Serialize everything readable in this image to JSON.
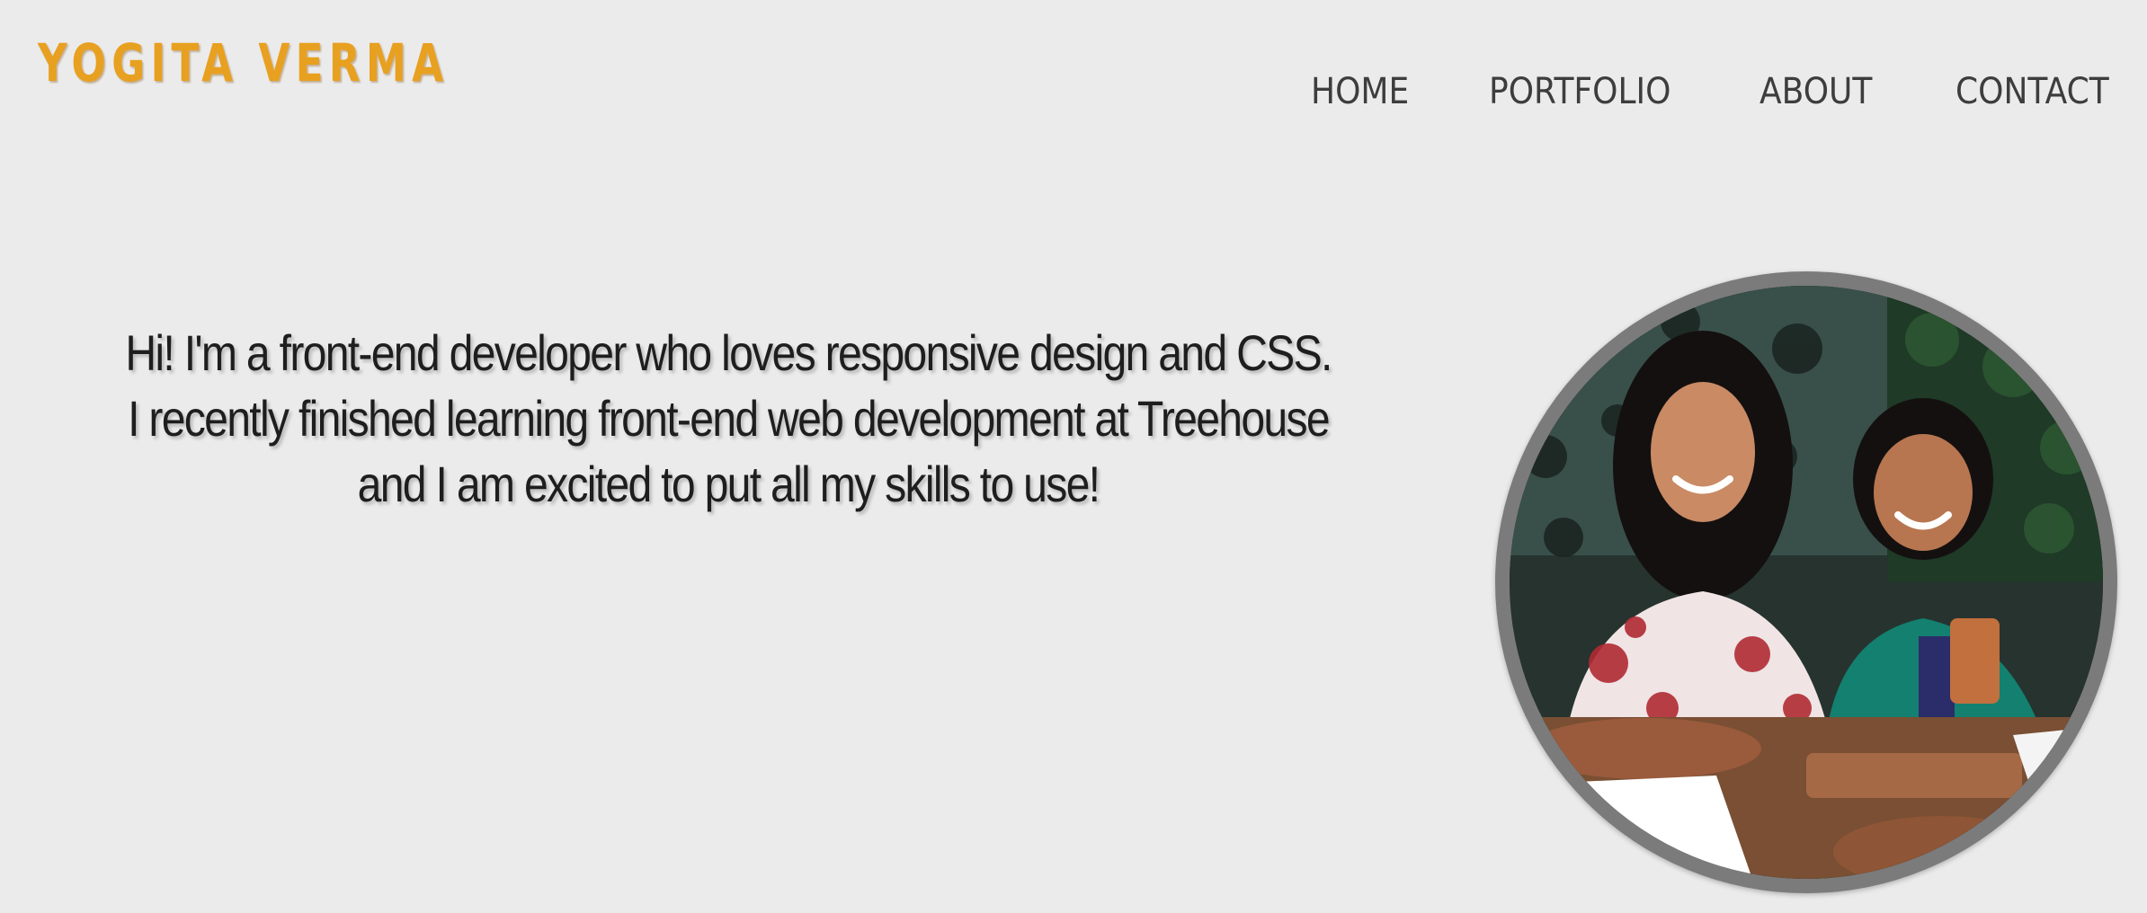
{
  "header": {
    "logo_text": "YOGITA VERMA"
  },
  "nav": {
    "items": [
      {
        "label": "HOME"
      },
      {
        "label": "PORTFOLIO"
      },
      {
        "label": "ABOUT"
      },
      {
        "label": "CONTACT"
      }
    ]
  },
  "main": {
    "intro_text": "Hi! I'm a front-end developer who loves responsive design and CSS. I recently finished learning front-end web development at Treehouse and I am excited to put all my skills to use!"
  },
  "colors": {
    "background": "#ebebeb",
    "logo": "#e8a020",
    "nav_text": "#3d3d3d",
    "body_text": "#1e1e1e",
    "photo_border": "#7b7b7b"
  }
}
